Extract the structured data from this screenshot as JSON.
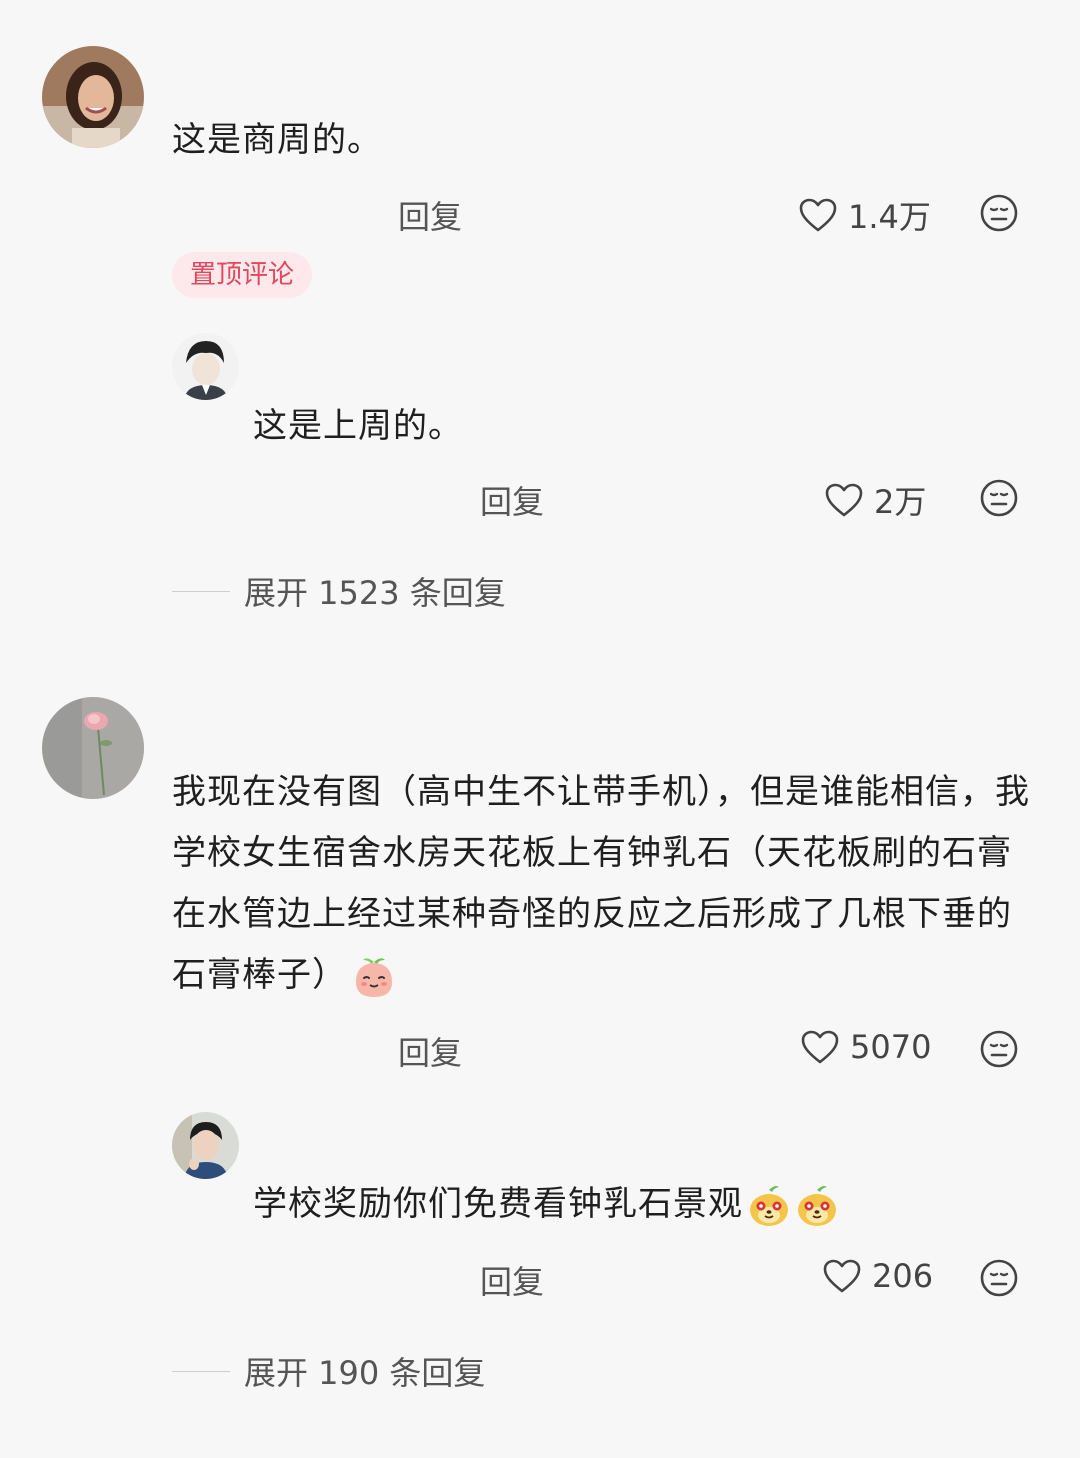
{
  "comments": [
    {
      "text": "这是商周的。",
      "reply_label": "回复",
      "likes": "1.4万",
      "badge": "置顶评论",
      "sub_reply": {
        "text": "这是上周的。",
        "reply_label": "回复",
        "likes": "2万"
      },
      "expand_label": "展开 1523 条回复"
    },
    {
      "text": "我现在没有图（高中生不让带手机），但是谁能相信，我学校女生宿舍水房天花板上有钟乳石（天花板刷的石膏在水管边上经过某种奇怪的反应之后形成了几根下垂的石膏棒子）",
      "reply_label": "回复",
      "likes": "5070",
      "sub_reply": {
        "text": "学校奖励你们免费看钟乳石景观",
        "reply_label": "回复",
        "likes": "206"
      },
      "expand_label": "展开 190 条回复"
    }
  ],
  "icons": {
    "like": "heart-outline-icon",
    "react": "neutral-face-icon",
    "inline_emojis": [
      "peach-face-emoji",
      "dog-face-emoji"
    ]
  },
  "colors": {
    "badge_bg": "#fde9ec",
    "badge_text": "#e2485c",
    "background": "#f7f7f7"
  }
}
